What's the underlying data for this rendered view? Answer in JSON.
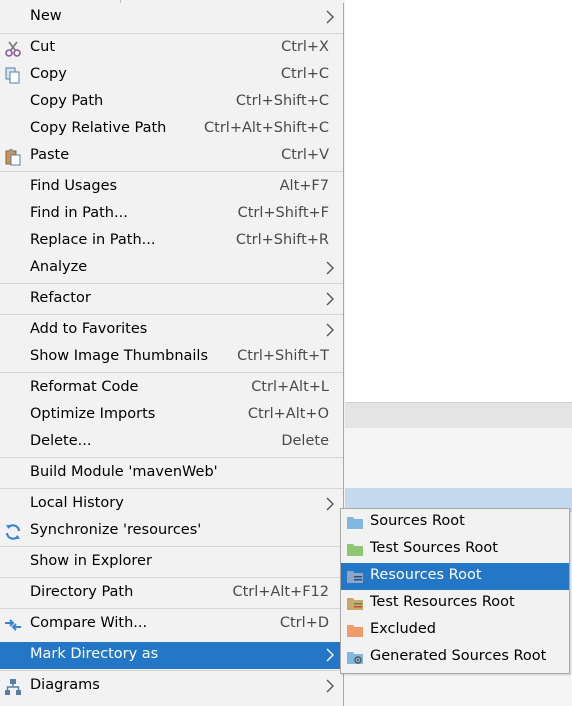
{
  "main_menu": {
    "items": [
      {
        "label": "New",
        "shortcut": "",
        "icon": "",
        "submenu": true
      },
      {
        "label": "Cut",
        "shortcut": "Ctrl+X",
        "icon": "scissors-icon",
        "submenu": false
      },
      {
        "label": "Copy",
        "shortcut": "Ctrl+C",
        "icon": "copy-icon",
        "submenu": false
      },
      {
        "label": "Copy Path",
        "shortcut": "Ctrl+Shift+C",
        "icon": "",
        "submenu": false
      },
      {
        "label": "Copy Relative Path",
        "shortcut": "Ctrl+Alt+Shift+C",
        "icon": "",
        "submenu": false
      },
      {
        "label": "Paste",
        "shortcut": "Ctrl+V",
        "icon": "paste-icon",
        "submenu": false
      },
      {
        "label": "Find Usages",
        "shortcut": "Alt+F7",
        "icon": "",
        "submenu": false
      },
      {
        "label": "Find in Path...",
        "shortcut": "Ctrl+Shift+F",
        "icon": "",
        "submenu": false
      },
      {
        "label": "Replace in Path...",
        "shortcut": "Ctrl+Shift+R",
        "icon": "",
        "submenu": false
      },
      {
        "label": "Analyze",
        "shortcut": "",
        "icon": "",
        "submenu": true
      },
      {
        "label": "Refactor",
        "shortcut": "",
        "icon": "",
        "submenu": true
      },
      {
        "label": "Add to Favorites",
        "shortcut": "",
        "icon": "",
        "submenu": true
      },
      {
        "label": "Show Image Thumbnails",
        "shortcut": "Ctrl+Shift+T",
        "icon": "",
        "submenu": false
      },
      {
        "label": "Reformat Code",
        "shortcut": "Ctrl+Alt+L",
        "icon": "",
        "submenu": false
      },
      {
        "label": "Optimize Imports",
        "shortcut": "Ctrl+Alt+O",
        "icon": "",
        "submenu": false
      },
      {
        "label": "Delete...",
        "shortcut": "Delete",
        "icon": "",
        "submenu": false
      },
      {
        "label": "Build Module 'mavenWeb'",
        "shortcut": "",
        "icon": "",
        "submenu": false
      },
      {
        "label": "Local History",
        "shortcut": "",
        "icon": "",
        "submenu": true
      },
      {
        "label": "Synchronize 'resources'",
        "shortcut": "",
        "icon": "sync-icon",
        "submenu": false
      },
      {
        "label": "Show in Explorer",
        "shortcut": "",
        "icon": "",
        "submenu": false
      },
      {
        "label": "Directory Path",
        "shortcut": "Ctrl+Alt+F12",
        "icon": "",
        "submenu": false
      },
      {
        "label": "Compare With...",
        "shortcut": "Ctrl+D",
        "icon": "compare-icon",
        "submenu": false
      },
      {
        "label": "Mark Directory as",
        "shortcut": "",
        "icon": "",
        "submenu": true,
        "highlighted": true
      },
      {
        "label": "Diagrams",
        "shortcut": "",
        "icon": "diagram-icon",
        "submenu": true
      }
    ]
  },
  "mark_directory_submenu": {
    "items": [
      {
        "label": "Sources Root",
        "icon": "sources-root-folder-icon",
        "color": "#82b8e0"
      },
      {
        "label": "Test Sources Root",
        "icon": "test-sources-root-folder-icon",
        "color": "#8fc672"
      },
      {
        "label": "Resources Root",
        "icon": "resources-root-folder-icon",
        "color": "#8aa6c8",
        "highlighted": true
      },
      {
        "label": "Test Resources Root",
        "icon": "test-resources-root-folder-icon",
        "color": "#c8a86b"
      },
      {
        "label": "Excluded",
        "icon": "excluded-folder-icon",
        "color": "#f09a6e"
      },
      {
        "label": "Generated Sources Root",
        "icon": "generated-sources-root-folder-icon",
        "color": "#82b8e0"
      }
    ]
  },
  "colors": {
    "highlight": "#2477c6",
    "menu_bg": "#f2f2f2",
    "separator": "#d6d6d6",
    "shortcut_text": "#4a4a4a"
  }
}
